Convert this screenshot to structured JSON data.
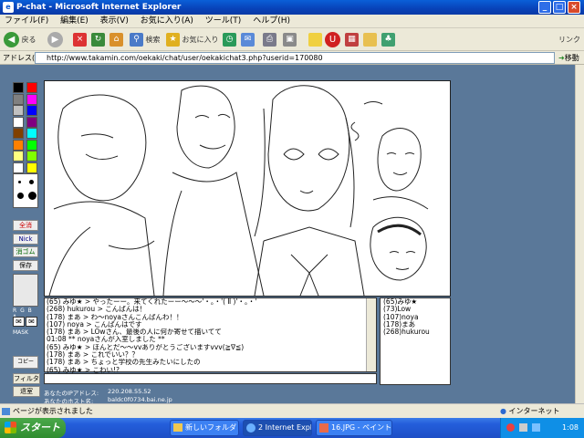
{
  "window": {
    "title": "P-chat - Microsoft Internet Explorer",
    "app_icon": "ie-icon"
  },
  "menu": [
    "ファイル(F)",
    "編集(E)",
    "表示(V)",
    "お気に入り(A)",
    "ツール(T)",
    "ヘルプ(H)"
  ],
  "toolbar": {
    "back_label": "戻る",
    "search_label": "検索",
    "favorites_label": "お気に入り",
    "links_label": "リンク"
  },
  "address": {
    "label": "アドレス(D)",
    "url": "http://www.takamin.com/oekaki/chat/user/oekakichat3.php?userid=170080",
    "go_label": "移動"
  },
  "palette": {
    "colors": [
      "#000000",
      "#ff0000",
      "#808080",
      "#ff00ff",
      "#c0c0c0",
      "#0000ff",
      "#ffffff",
      "#800080",
      "#804000",
      "#00ffff",
      "#ff8000",
      "#00ff00",
      "#ffff80",
      "#80ff00",
      "#ffffff",
      "#ffff00"
    ]
  },
  "tools": {
    "clear_label": "全消",
    "nick_label": "Nick",
    "eraser_label": "消ゴム",
    "save_label": "保存",
    "slider_marks": "R G B A",
    "mask_label": "MASK",
    "copy_label": "コピー"
  },
  "chat_messages": [
    "(65) みゆ★ > やったーー。来てくれたーー〜〜〜'・。・'( Ⅱ )'・。・'",
    "(268) hukurou > こんばんは！",
    "(178) まあ > わ〜noyaさんこんばんわ！！",
    "(107) noya > こんばんはです",
    "(178) まあ > LOwさん、最後の人に何か寄せて描いてて",
    "01:08 ** noyaさんが入室しました **",
    "(65) みゆ★ > ほんとだ〜〜vvありがとうございますvvv(≧∇≦)",
    "(178) まあ > これでいい？？",
    "(178) まあ > ちょっと学校の先生みたいにしたの",
    "(65) みゆ★ > こわい!?"
  ],
  "users": [
    "(65)みゆ★",
    "(73)Low",
    "(107)noya",
    "(178)まあ",
    "(268)hukurou"
  ],
  "filter_label": "フィルタ",
  "leave_label": "退室",
  "info": {
    "ip_label": "あなたのIPアドレス:",
    "ip": "220.208.55.52",
    "host_label": "あなたのホスト名:",
    "host": "baldc0f0734.bai.ne.jp"
  },
  "status": {
    "text": "ページが表示されました",
    "zone": "インターネット"
  },
  "taskbar": {
    "start_label": "スタート",
    "tasks": [
      "新しいフォルダ",
      "2 Internet Expl...",
      "16.JPG - ペイント"
    ],
    "time": "1:08"
  }
}
